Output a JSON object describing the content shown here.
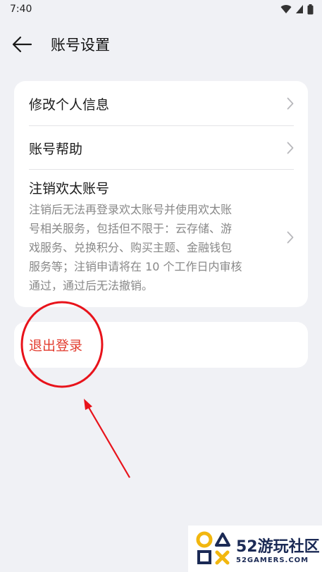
{
  "status_bar": {
    "time": "7:40"
  },
  "header": {
    "title": "账号设置",
    "back_icon": "arrow-left-icon"
  },
  "settings": {
    "items": [
      {
        "label": "修改个人信息",
        "icon": "chevron-right-icon"
      },
      {
        "label": "账号帮助",
        "icon": "chevron-right-icon"
      },
      {
        "label": "注销欢太账号",
        "description_lines": [
          "注销后无法再登录欢太账号并使用欢太账",
          "号相关服务，包括但不限于：云存储、游",
          "戏服务、兑换积分、购买主题、金融钱包",
          "服务等；注销申请将在 10 个工作日内审核",
          "通过，通过后无法撤销。"
        ],
        "icon": "chevron-right-icon"
      }
    ]
  },
  "logout": {
    "label": "退出登录"
  },
  "colors": {
    "danger": "#e23b2e",
    "annotation": "#e8131b",
    "background": "#f0f1f5"
  },
  "watermark": {
    "brand": "52游玩社区",
    "domain": "52GAMERS.COM"
  }
}
